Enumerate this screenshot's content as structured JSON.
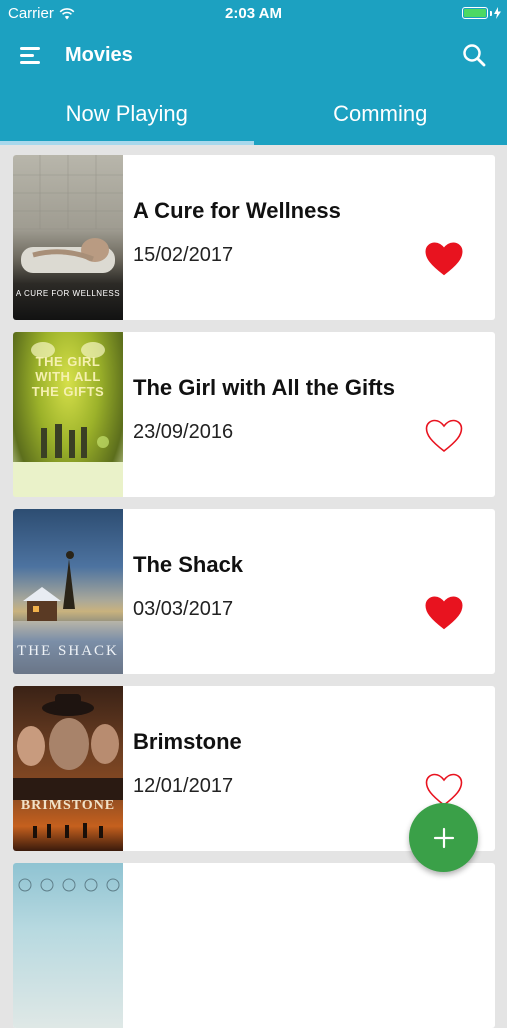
{
  "status_bar": {
    "carrier": "Carrier",
    "time": "2:03 AM",
    "battery_level": 1.0
  },
  "nav": {
    "title": "Movies",
    "menu_icon": "menu-icon",
    "search_icon": "search-icon"
  },
  "tabs": [
    {
      "label": "Now Playing",
      "selected": true
    },
    {
      "label": "Comming",
      "selected": false
    }
  ],
  "movies": [
    {
      "title": "A Cure for Wellness",
      "date": "15/02/2017",
      "favorite": true,
      "poster_text": "A CURE FOR WELLNESS"
    },
    {
      "title": "The Girl with All the Gifts",
      "date": "23/09/2016",
      "favorite": false,
      "poster_text": "THE GIRL WITH ALL THE GIFTS"
    },
    {
      "title": "The Shack",
      "date": "03/03/2017",
      "favorite": true,
      "poster_text": "THE SHACK"
    },
    {
      "title": "Brimstone",
      "date": "12/01/2017",
      "favorite": false,
      "poster_text": "BRIMSTONE"
    }
  ],
  "fab": {
    "icon": "plus-icon"
  },
  "colors": {
    "primary": "#1ca1c1",
    "tab_indicator": "#a8d8ec",
    "heart": "#e8131f",
    "fab": "#3aa048",
    "background": "#e4e4e4"
  }
}
